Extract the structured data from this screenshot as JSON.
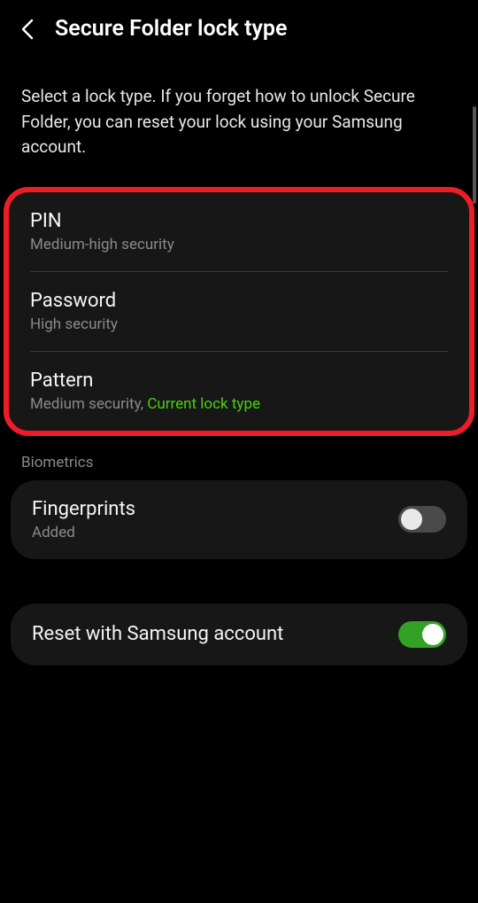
{
  "header": {
    "title": "Secure Folder lock type"
  },
  "description": "Select a lock type. If you forget how to unlock Secure Folder, you can reset your lock using your Samsung account.",
  "lockTypes": {
    "pin": {
      "title": "PIN",
      "subtitle": "Medium-high security"
    },
    "password": {
      "title": "Password",
      "subtitle": "High security"
    },
    "pattern": {
      "title": "Pattern",
      "subtitle_prefix": "Medium security, ",
      "current_label": "Current lock type"
    }
  },
  "biometrics": {
    "section_label": "Biometrics",
    "fingerprints": {
      "title": "Fingerprints",
      "subtitle": "Added"
    }
  },
  "reset": {
    "title": "Reset with Samsung account"
  }
}
